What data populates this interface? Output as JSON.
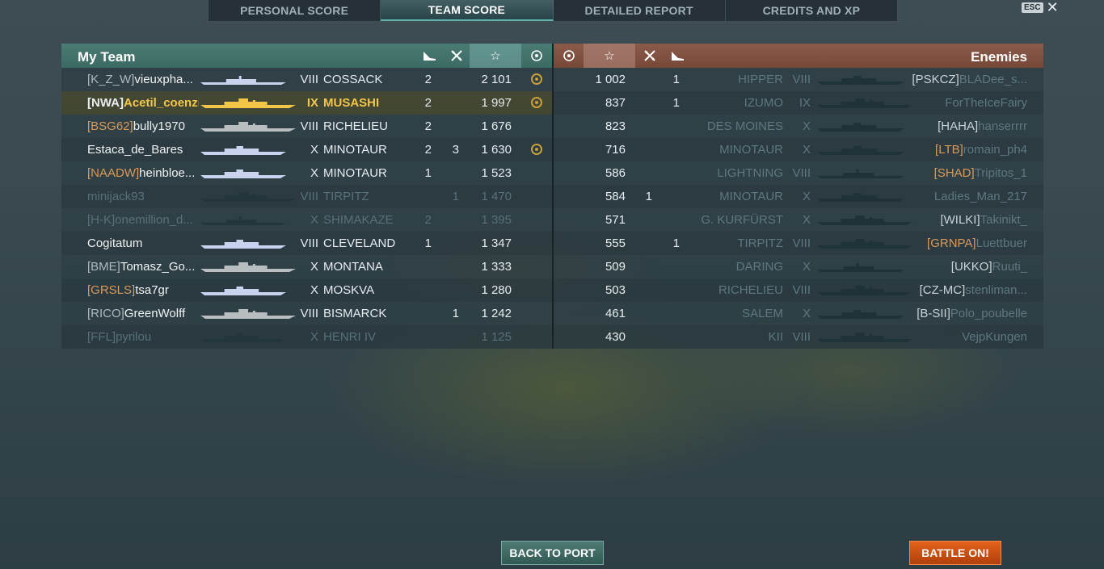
{
  "tabs": [
    {
      "label": "PERSONAL SCORE",
      "active": false
    },
    {
      "label": "TEAM SCORE",
      "active": true
    },
    {
      "label": "DETAILED REPORT",
      "active": false
    },
    {
      "label": "CREDITS AND XP",
      "active": false
    }
  ],
  "esc_label": "ESC",
  "close_glyph": "✕",
  "my_team": {
    "title": "My Team",
    "header_icons": [
      "torpedo-icon",
      "plane-icon",
      "star-icon",
      "medal-icon"
    ],
    "players": [
      {
        "clan": "[K_Z_W]",
        "clan_division": false,
        "name": "vieuxpha...",
        "tier": "VIII",
        "ship": "COSSACK",
        "kills": "2",
        "planes": "",
        "score": "2 101",
        "medal": true,
        "alive": true,
        "self": false,
        "ship_class": "dd"
      },
      {
        "clan": "[NWA]",
        "clan_division": false,
        "name": "Acetil_coenzi...",
        "tier": "IX",
        "ship": "MUSASHI",
        "kills": "2",
        "planes": "",
        "score": "1 997",
        "medal": true,
        "alive": true,
        "self": true,
        "ship_class": "bb"
      },
      {
        "clan": "[BSG62]",
        "clan_division": true,
        "name": "bully1970",
        "tier": "VIII",
        "ship": "RICHELIEU",
        "kills": "2",
        "planes": "",
        "score": "1 676",
        "medal": false,
        "alive": true,
        "self": false,
        "ship_class": "bb"
      },
      {
        "clan": "",
        "clan_division": false,
        "name": "Estaca_de_Bares",
        "tier": "X",
        "ship": "MINOTAUR",
        "kills": "2",
        "planes": "3",
        "score": "1 630",
        "medal": true,
        "alive": true,
        "self": false,
        "ship_class": "ca"
      },
      {
        "clan": "[NAADW]",
        "clan_division": true,
        "name": "heinbloe...",
        "tier": "X",
        "ship": "MINOTAUR",
        "kills": "1",
        "planes": "",
        "score": "1 523",
        "medal": false,
        "alive": true,
        "self": false,
        "ship_class": "ca"
      },
      {
        "clan": "",
        "clan_division": false,
        "name": "minijack93",
        "tier": "VIII",
        "ship": "TIRPITZ",
        "kills": "",
        "planes": "1",
        "score": "1 470",
        "medal": false,
        "alive": false,
        "self": false,
        "ship_class": "bb"
      },
      {
        "clan": "[H-K]",
        "clan_division": false,
        "name": "onemillion_d...",
        "tier": "X",
        "ship": "SHIMAKAZE",
        "kills": "2",
        "planes": "",
        "score": "1 395",
        "medal": false,
        "alive": false,
        "self": false,
        "ship_class": "dd"
      },
      {
        "clan": "",
        "clan_division": false,
        "name": "Cogitatum",
        "tier": "VIII",
        "ship": "CLEVELAND",
        "kills": "1",
        "planes": "",
        "score": "1 347",
        "medal": false,
        "alive": true,
        "self": false,
        "ship_class": "ca"
      },
      {
        "clan": "[BME]",
        "clan_division": false,
        "name": "Tomasz_Go...",
        "tier": "X",
        "ship": "MONTANA",
        "kills": "",
        "planes": "",
        "score": "1 333",
        "medal": false,
        "alive": true,
        "self": false,
        "ship_class": "bb"
      },
      {
        "clan": "[GRSLS]",
        "clan_division": true,
        "name": "tsa7gr",
        "tier": "X",
        "ship": "MOSKVA",
        "kills": "",
        "planes": "",
        "score": "1 280",
        "medal": false,
        "alive": true,
        "self": false,
        "ship_class": "ca"
      },
      {
        "clan": "[RICO]",
        "clan_division": false,
        "name": "GreenWolff",
        "tier": "VIII",
        "ship": "BISMARCK",
        "kills": "",
        "planes": "1",
        "score": "1 242",
        "medal": false,
        "alive": true,
        "self": false,
        "ship_class": "bb"
      },
      {
        "clan": "[FFL]",
        "clan_division": true,
        "name": "pyrilou",
        "tier": "X",
        "ship": "HENRI IV",
        "kills": "",
        "planes": "",
        "score": "1 125",
        "medal": false,
        "alive": false,
        "self": false,
        "ship_class": "ca"
      }
    ]
  },
  "enemies": {
    "title": "Enemies",
    "header_icons": [
      "medal-icon",
      "star-icon",
      "plane-icon",
      "torpedo-icon"
    ],
    "players": [
      {
        "score": "1 002",
        "planes": "",
        "kills": "1",
        "ship": "HIPPER",
        "tier": "VIII",
        "clan": "[PSKCZ]",
        "clan_division": false,
        "name": "BLADee_s...",
        "ship_class": "ca"
      },
      {
        "score": "837",
        "planes": "",
        "kills": "1",
        "ship": "IZUMO",
        "tier": "IX",
        "clan": "",
        "clan_division": false,
        "name": "ForTheIceFairy",
        "ship_class": "bb"
      },
      {
        "score": "823",
        "planes": "",
        "kills": "",
        "ship": "DES MOINES",
        "tier": "X",
        "clan": "[HAHA]",
        "clan_division": false,
        "name": "hanserrrr",
        "ship_class": "ca"
      },
      {
        "score": "716",
        "planes": "",
        "kills": "",
        "ship": "MINOTAUR",
        "tier": "X",
        "clan": "[LTB]",
        "clan_division": true,
        "name": "romain_ph4",
        "ship_class": "ca"
      },
      {
        "score": "586",
        "planes": "",
        "kills": "",
        "ship": "LIGHTNING",
        "tier": "VIII",
        "clan": "[SHAD]",
        "clan_division": true,
        "name": "Tripitos_1",
        "ship_class": "dd"
      },
      {
        "score": "584",
        "planes": "1",
        "kills": "",
        "ship": "MINOTAUR",
        "tier": "X",
        "clan": "",
        "clan_division": false,
        "name": "Ladies_Man_217",
        "ship_class": "ca"
      },
      {
        "score": "571",
        "planes": "",
        "kills": "",
        "ship": "G. KURFÜRST",
        "tier": "X",
        "clan": "[WILKI]",
        "clan_division": false,
        "name": "Takinikt_",
        "ship_class": "bb"
      },
      {
        "score": "555",
        "planes": "",
        "kills": "1",
        "ship": "TIRPITZ",
        "tier": "VIII",
        "clan": "[GRNPA]",
        "clan_division": true,
        "name": "Luettbuer",
        "ship_class": "bb"
      },
      {
        "score": "509",
        "planes": "",
        "kills": "",
        "ship": "DARING",
        "tier": "X",
        "clan": "[UKKO]",
        "clan_division": false,
        "name": "Ruuti_",
        "ship_class": "dd"
      },
      {
        "score": "503",
        "planes": "",
        "kills": "",
        "ship": "RICHELIEU",
        "tier": "VIII",
        "clan": "[CZ-MC]",
        "clan_division": false,
        "name": "stenliman...",
        "ship_class": "bb"
      },
      {
        "score": "461",
        "planes": "",
        "kills": "",
        "ship": "SALEM",
        "tier": "X",
        "clan": "[B-SII]",
        "clan_division": false,
        "name": "Polo_poubelle",
        "ship_class": "ca"
      },
      {
        "score": "430",
        "planes": "",
        "kills": "",
        "ship": "KII",
        "tier": "VIII",
        "clan": "",
        "clan_division": false,
        "name": "VejpKungen",
        "ship_class": "bb"
      }
    ]
  },
  "buttons": {
    "back": "BACK TO PORT",
    "battle": "BATTLE ON!"
  },
  "colors": {
    "my_team_header": "#3b6a63",
    "enemy_header": "#774838",
    "self_highlight": "#f3c64a",
    "division_clan": "#d99a5a",
    "battle_button": "#c8500f"
  }
}
